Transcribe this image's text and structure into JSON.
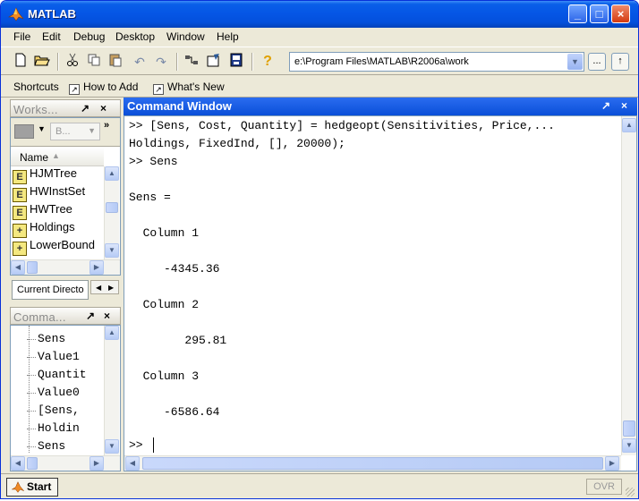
{
  "app": {
    "title": "MATLAB"
  },
  "window_controls": {
    "minimize": "_",
    "maximize": "□",
    "close": "×"
  },
  "menu": [
    "File",
    "Edit",
    "Debug",
    "Desktop",
    "Window",
    "Help"
  ],
  "toolbar": {
    "icons": [
      "new-file-icon",
      "open-folder-icon",
      "cut-icon",
      "copy-icon",
      "paste-icon",
      "undo-icon",
      "redo-icon",
      "simulink-icon",
      "guide-icon",
      "profiler-icon",
      "help-icon"
    ],
    "current_directory": "e:\\Program Files\\MATLAB\\R2006a\\work",
    "browse_label": "...",
    "up_folder_label": "↑"
  },
  "shortcuts": {
    "label": "Shortcuts",
    "items": [
      "How to Add",
      "What's New"
    ]
  },
  "workspace": {
    "title": "Works...",
    "toolbar_dropdown": "B...",
    "column": "Name",
    "items": [
      {
        "name": "HJMTree",
        "icon": "struct-icon"
      },
      {
        "name": "HWInstSet",
        "icon": "struct-icon"
      },
      {
        "name": "HWTree",
        "icon": "struct-icon"
      },
      {
        "name": "Holdings",
        "icon": "matrix-icon"
      },
      {
        "name": "LowerBound",
        "icon": "matrix-icon"
      }
    ],
    "tab": "Current Directo"
  },
  "history": {
    "title": "Comma...",
    "items": [
      "Sens",
      "Value1",
      "Quantit",
      "Value0",
      "[Sens,",
      "Holdin",
      "Sens"
    ]
  },
  "command_window": {
    "title": "Command Window",
    "lines": [
      ">> [Sens, Cost, Quantity] = hedgeopt(Sensitivities, Price,...",
      "Holdings, FixedInd, [], 20000);",
      ">> Sens",
      "",
      "Sens =",
      "",
      "  Column 1",
      "",
      "     -4345.36",
      "",
      "  Column 2",
      "",
      "        295.81",
      "",
      "  Column 3",
      "",
      "     -6586.64",
      "",
      ">>"
    ]
  },
  "status": {
    "start_label": "Start",
    "ovr": "OVR"
  },
  "colors": {
    "title_blue": "#0556e6",
    "pane_blue": "#0a4fd8",
    "face": "#ece9d8"
  }
}
